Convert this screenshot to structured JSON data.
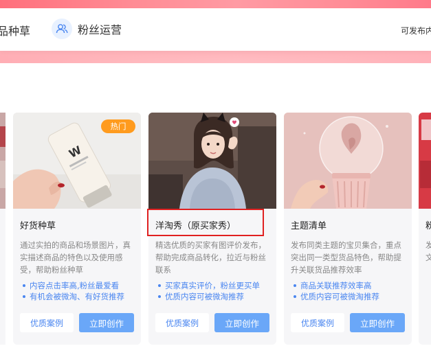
{
  "header": {
    "partial_tab": "品种草",
    "fans_tab": "粉丝运营",
    "publish_hint": "可发布内"
  },
  "cards": [
    {
      "title": "好货种草",
      "badge": "热门",
      "description": "通过实拍的商品和场景图片，真实描述商品的特色以及使用感受，帮助粉丝种草",
      "bullets": [
        "内容点击率高,粉丝最爱看",
        "有机会被微淘、有好货推荐"
      ],
      "case_button": "优质案例",
      "create_button": "立即创作"
    },
    {
      "title": "洋淘秀（原买家秀）",
      "description": "精选优质的买家有图评价发布，帮助完成商品转化，拉近与粉丝联系",
      "bullets": [
        "买家真实评价，粉丝更买单",
        "优质内容可被微淘推荐"
      ],
      "case_button": "优质案例",
      "create_button": "立即创作"
    },
    {
      "title": "主题清单",
      "description": "发布同类主题的宝贝集合，重点突出同一类型货品特色，帮助提升关联货品推荐效率",
      "bullets": [
        "商品关联推荐效率高",
        "优质内容可被微淘推荐"
      ],
      "case_button": "优质案例",
      "create_button": "立即创作"
    }
  ],
  "edge_card": {
    "title": "粉",
    "description": "发力文"
  },
  "colors": {
    "accent_blue": "#4a86f0",
    "create_button": "#6aa7f8",
    "hot_badge": "#ff9b1e",
    "highlight": "#e02020",
    "banner": "#ff8b94"
  }
}
